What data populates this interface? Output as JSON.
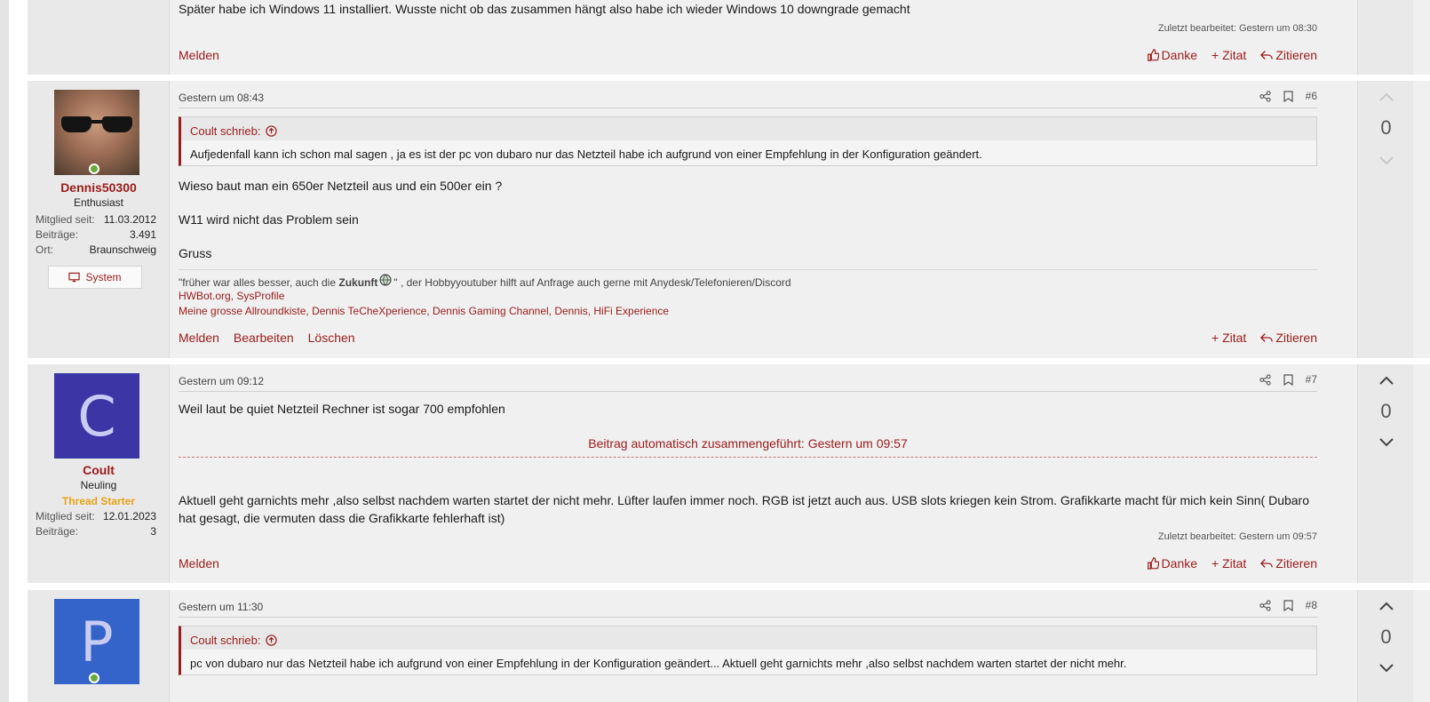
{
  "post5": {
    "text": "Später habe ich Windows 11 installiert. Wusste nicht ob das zusammen hängt also habe ich wieder Windows 10 downgrade gemacht",
    "edited": "Zuletzt bearbeitet: Gestern um 08:30",
    "report": "Melden",
    "like": "Danke",
    "add_quote": "+ Zitat",
    "reply": "Zitieren"
  },
  "post6": {
    "date": "Gestern um 08:43",
    "number": "#6",
    "user": {
      "name": "Dennis50300",
      "title": "Enthusiast",
      "member_since_label": "Mitglied seit:",
      "member_since": "11.03.2012",
      "posts_label": "Beiträge:",
      "posts": "3.491",
      "location_label": "Ort:",
      "location": "Braunschweig",
      "system_button": "System"
    },
    "quote": {
      "author": "Coult schrieb:",
      "text": "Aufjedenfall kann ich schon mal sagen , ja es ist der pc von dubaro nur das Netzteil habe ich aufgrund von einer Empfehlung in der Konfiguration geändert."
    },
    "lines": [
      "Wieso baut man ein 650er Netzteil aus und ein 500er ein ?",
      "W11 wird nicht das Problem sein",
      "Gruss"
    ],
    "signature": {
      "line1_pre": "\"früher war alles besser, auch die ",
      "line1_bold": "Zukunft",
      "line1_post": "\" , der Hobbyyoutuber hilft auf Anfrage auch gerne mit Anydesk/Telefonieren/Discord",
      "line2": "HWBot.org, SysProfile",
      "line3": "Meine grosse Allroundkiste, Dennis TeCheXperience, Dennis Gaming Channel, Dennis, HiFi Experience"
    },
    "report": "Melden",
    "edit": "Bearbeiten",
    "delete": "Löschen",
    "add_quote": "+ Zitat",
    "reply": "Zitieren",
    "votes": "0"
  },
  "post7": {
    "date": "Gestern um 09:12",
    "number": "#7",
    "user": {
      "initial": "C",
      "avatar_color": "#3b35a6",
      "name": "Coult",
      "title": "Neuling",
      "badge": "Thread Starter",
      "member_since_label": "Mitglied seit:",
      "member_since": "12.01.2023",
      "posts_label": "Beiträge:",
      "posts": "3"
    },
    "text1": "Weil laut be quiet Netzteil Rechner ist sogar 700 empfohlen",
    "merged": "Beitrag automatisch zusammengeführt: Gestern um 09:57",
    "text2": "Aktuell geht garnichts mehr ,also selbst nachdem warten startet der nicht mehr. Lüfter laufen immer noch. RGB ist jetzt auch aus. USB slots kriegen kein Strom. Grafikkarte macht für mich kein Sinn( Dubaro hat gesagt, die vermuten dass die Grafikkarte fehlerhaft ist)",
    "edited": "Zuletzt bearbeitet: Gestern um 09:57",
    "report": "Melden",
    "like": "Danke",
    "add_quote": "+ Zitat",
    "reply": "Zitieren",
    "votes": "0"
  },
  "post8": {
    "date": "Gestern um 11:30",
    "number": "#8",
    "user": {
      "initial": "P",
      "avatar_color": "#3463c9"
    },
    "quote": {
      "author": "Coult schrieb:",
      "text": "pc von dubaro nur das Netzteil habe ich aufgrund von einer Empfehlung in der Konfiguration geändert... Aktuell geht garnichts mehr ,also selbst nachdem warten startet der nicht mehr."
    },
    "votes": "0"
  },
  "icons": {
    "share": "share-icon",
    "bookmark": "bookmark-icon",
    "like": "thumbs-up-icon",
    "reply": "reply-icon",
    "up": "chevron-up-icon",
    "down": "chevron-down-icon",
    "monitor": "monitor-icon",
    "quote_up": "arrow-up-circle-icon"
  },
  "colors": {
    "accent": "#9b1b1b",
    "thread_starter": "#e8a317",
    "online": "#6aaa3a"
  }
}
